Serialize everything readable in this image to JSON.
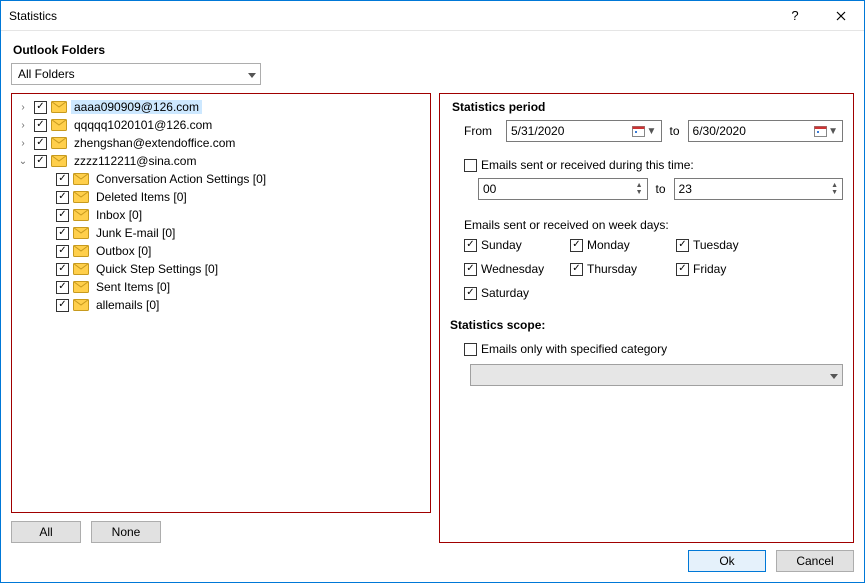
{
  "window": {
    "title": "Statistics"
  },
  "header": {
    "label": "Outlook Folders"
  },
  "folderCombo": {
    "value": "All Folders"
  },
  "tree": {
    "accounts": [
      {
        "label": "aaaa090909@126.com",
        "expanded": false,
        "checked": true,
        "selected": true,
        "hasChildren": true
      },
      {
        "label": "qqqqq1020101@126.com",
        "expanded": false,
        "checked": true,
        "selected": false,
        "hasChildren": true
      },
      {
        "label": "zhengshan@extendoffice.com",
        "expanded": false,
        "checked": true,
        "selected": false,
        "hasChildren": true
      },
      {
        "label": "zzzz112211@sina.com",
        "expanded": true,
        "checked": true,
        "selected": false,
        "hasChildren": true,
        "children": [
          {
            "label": "Conversation Action Settings [0]",
            "checked": true
          },
          {
            "label": "Deleted Items [0]",
            "checked": true
          },
          {
            "label": "Inbox [0]",
            "checked": true
          },
          {
            "label": "Junk E-mail [0]",
            "checked": true
          },
          {
            "label": "Outbox [0]",
            "checked": true
          },
          {
            "label": "Quick Step Settings [0]",
            "checked": true
          },
          {
            "label": "Sent Items [0]",
            "checked": true
          },
          {
            "label": "allemails [0]",
            "checked": true
          }
        ]
      }
    ]
  },
  "leftButtons": {
    "all": "All",
    "none": "None"
  },
  "period": {
    "header": "Statistics period",
    "fromLabel": "From",
    "fromValue": "5/31/2020",
    "toLabel": "to",
    "toValue": "6/30/2020",
    "timeCheckLabel": "Emails sent or received during this time:",
    "timeChecked": false,
    "timeFrom": "00",
    "timeToLabel": "to",
    "timeTo": "23",
    "weekdaysLabel": "Emails sent or received on week days:",
    "days": [
      {
        "label": "Sunday",
        "checked": true
      },
      {
        "label": "Monday",
        "checked": true
      },
      {
        "label": "Tuesday",
        "checked": true
      },
      {
        "label": "Wednesday",
        "checked": true
      },
      {
        "label": "Thursday",
        "checked": true
      },
      {
        "label": "Friday",
        "checked": true
      },
      {
        "label": "Saturday",
        "checked": true
      }
    ]
  },
  "scope": {
    "header": "Statistics scope:",
    "categoryCheckLabel": "Emails only with specified category",
    "categoryChecked": false
  },
  "footer": {
    "ok": "Ok",
    "cancel": "Cancel"
  }
}
